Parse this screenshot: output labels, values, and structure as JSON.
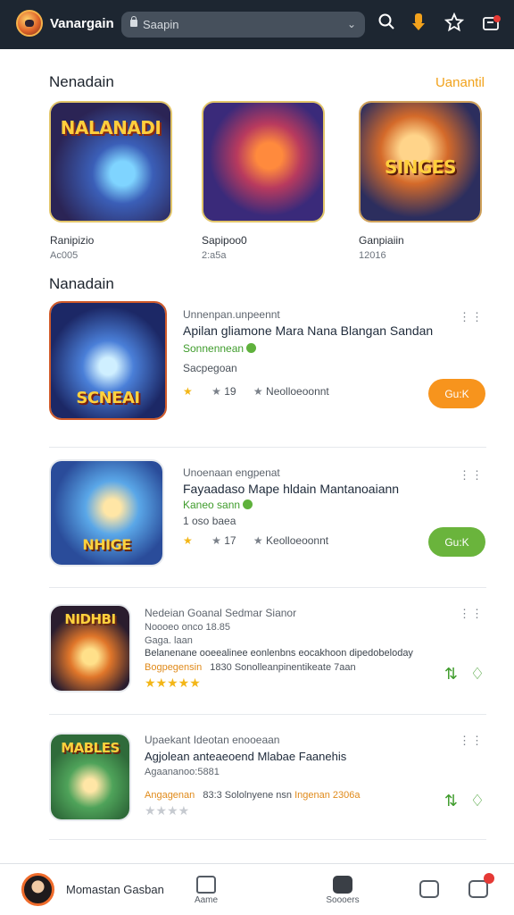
{
  "app": {
    "title": "Vanargain"
  },
  "search": {
    "placeholder": "Saapin"
  },
  "toolbar": {
    "icons": [
      "search-icon",
      "download-icon",
      "star-icon",
      "notification-box-icon"
    ]
  },
  "featured": {
    "title": "Nenadain",
    "see_all": "Uanantil",
    "cards": [
      {
        "art_text": "NALANADI",
        "name": "Ranipizio",
        "meta": "Ac005"
      },
      {
        "art_text": "",
        "name": "Sapipoo0",
        "meta": "2:a5a"
      },
      {
        "art_text": "SINGES",
        "name": "Ganpiaiin",
        "meta": "12016"
      }
    ]
  },
  "list": {
    "title": "Nanadain",
    "items": [
      {
        "art_text": "SCNEAI",
        "category": "Unnenpan.unpeennt",
        "title": "Apilan gliamone Mara Nana Blangan Sandan",
        "developer": "Sonnennean",
        "size": "Sacpegoan",
        "rating": "1",
        "downloads": "19",
        "tag": "Neolloeoonnt",
        "button": "Gu:K"
      },
      {
        "art_text": "NHIGE",
        "category": "Unoenaan engpenat",
        "title": "Fayaadaso Mape hldain Mantanoaiann",
        "developer": "Kaneo sann",
        "size": "1 oso baea",
        "rating": "1",
        "downloads": "17",
        "tag": "Keolloeoonnt",
        "button": "Gu:K"
      },
      {
        "art_text": "NIDHBI",
        "category": "Nedeian Goanal Sedmar Sianor",
        "title": "Noooeo onco 18.85",
        "developer": "Bogpegensin",
        "size": "Gaga. laan",
        "description": "Belanenane ooeealinee eonlenbns eocakhoon dipedobeloday",
        "meta": "1830 Sonolleanpinentikeate 7aan",
        "stars": 5
      },
      {
        "art_text": "MABLES",
        "category": "Upaekant Ideotan enooeaan",
        "title": "Agjolean anteaeoend Mlabae Faanehis",
        "developer": "Angagenan",
        "size": "Agaananoo:5881",
        "meta": "83:3 Sololnyene nsn",
        "meta_accent": "Ingenan 2306a",
        "stars": 0
      }
    ]
  },
  "bottom_nav": {
    "user": "Momastan Gasban",
    "items": [
      {
        "label": "Aame"
      },
      {
        "label": "Soooers"
      },
      {
        "label": ""
      },
      {
        "label": ""
      }
    ]
  },
  "colors": {
    "accent": "#f1a21b",
    "install_orange": "#f7941d",
    "install_green": "#6ab43c",
    "topbar": "#1d2631"
  }
}
